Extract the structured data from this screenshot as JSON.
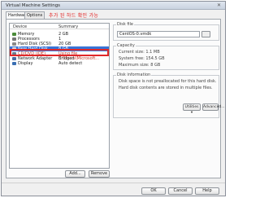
{
  "window": {
    "title": "Virtual Machine Settings"
  },
  "tabs": [
    {
      "label": "Hardware"
    },
    {
      "label": "Options"
    }
  ],
  "annotation": "추가 된 하드 확인 가능",
  "device_list": {
    "columns": [
      "Device",
      "Summary"
    ],
    "rows": [
      {
        "device": "Memory",
        "summary": "2 GB",
        "icon": "memory-icon",
        "color": "#4b8c3a"
      },
      {
        "device": "Processors",
        "summary": "1",
        "icon": "cpu-icon",
        "color": "#777777"
      },
      {
        "device": "Hard Disk (SCSI)",
        "summary": "20 GB",
        "icon": "hard-disk-icon",
        "color": "#8a8a8a"
      },
      {
        "device": "New Hard Disk ...",
        "summary": "8 GB",
        "icon": "hard-disk-icon",
        "color": "#dddddd"
      },
      {
        "device": "CD/DVD (IDE)",
        "summary": "Using file C:\\Users\\Microsoft...",
        "icon": "cdrom-icon",
        "color": "#6c7c8c"
      },
      {
        "device": "Network Adapter",
        "summary": "Bridged",
        "icon": "network-icon",
        "color": "#4a6ca0"
      },
      {
        "device": "Display",
        "summary": "Auto detect",
        "icon": "display-icon",
        "color": "#3a6fb3"
      }
    ],
    "selected_index": 3
  },
  "buttons": {
    "add": "Add...",
    "remove": "Remove",
    "utilities": "Utilities",
    "advanced": "Advanced...",
    "ok": "OK",
    "cancel": "Cancel",
    "help": "Help"
  },
  "disk_file": {
    "title": "Disk file",
    "value": "CentOS-0.vmdk"
  },
  "capacity": {
    "title": "Capacity",
    "current_size": "Current size: 1.1 MB",
    "system_free": "System free: 154.5 GB",
    "maximum_size": "Maximum size: 8 GB"
  },
  "disk_information": {
    "title": "Disk information",
    "line1": "Disk space is not preallocated for this hard disk.",
    "line2": "Hard disk contents are stored in multiple files."
  },
  "colors": {
    "accent": "#3875d7",
    "annotation": "#e02020"
  }
}
